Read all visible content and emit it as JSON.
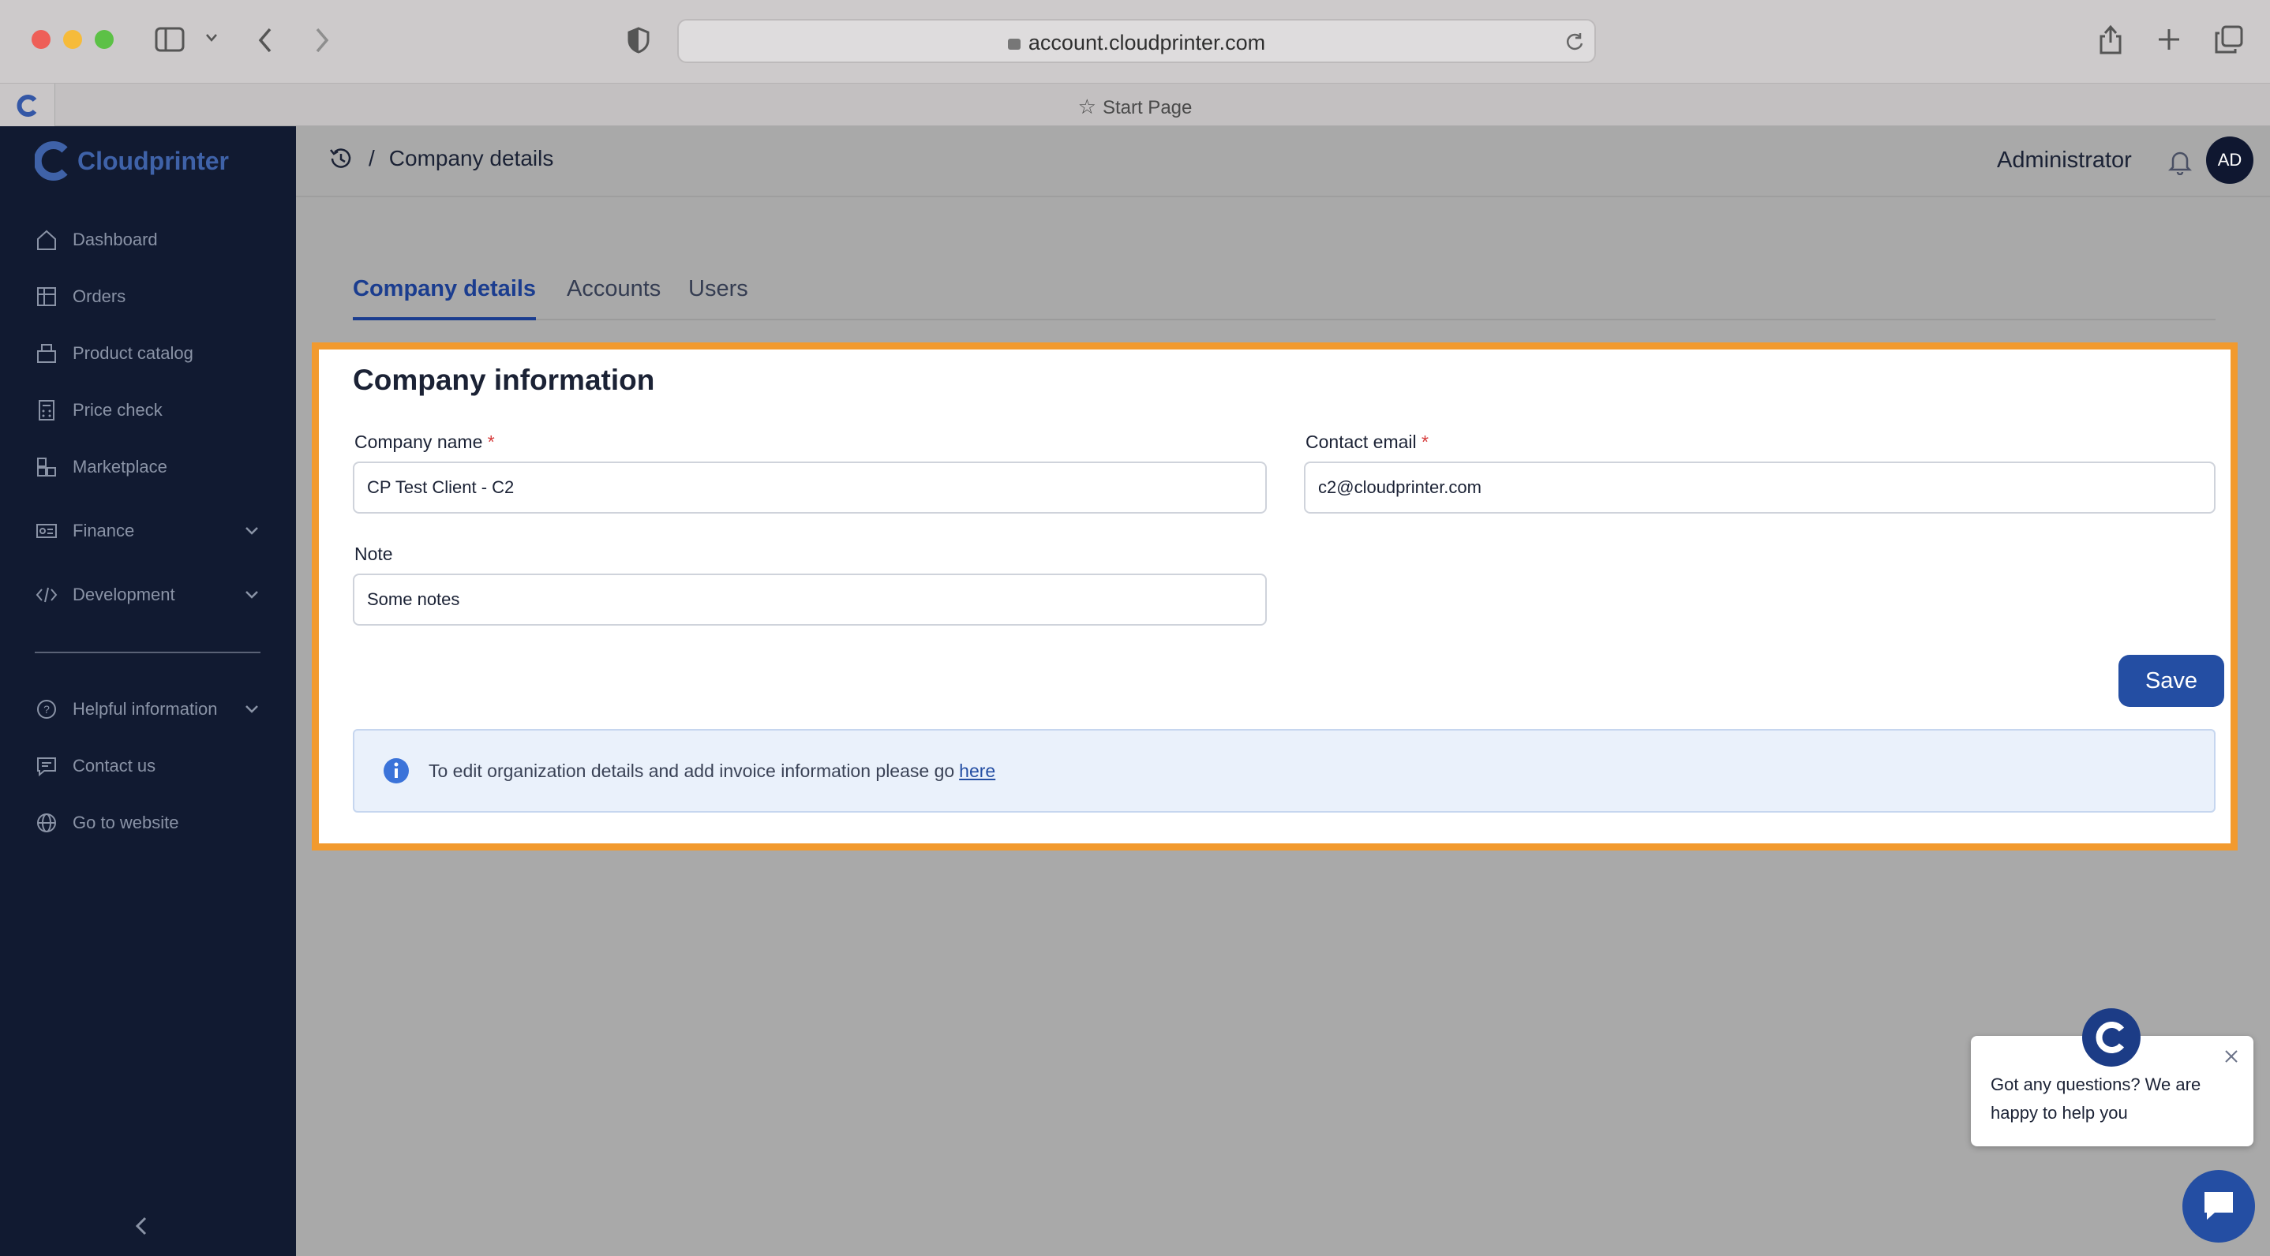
{
  "browser": {
    "url": "account.cloudprinter.com",
    "tab_title": "Start Page"
  },
  "sidebar": {
    "logo_text": "Cloudprinter",
    "items": [
      {
        "label": "Dashboard",
        "icon": "home-icon"
      },
      {
        "label": "Orders",
        "icon": "orders-icon"
      },
      {
        "label": "Product catalog",
        "icon": "product-catalog-icon"
      },
      {
        "label": "Price check",
        "icon": "calculator-icon"
      },
      {
        "label": "Marketplace",
        "icon": "marketplace-icon"
      },
      {
        "label": "Finance",
        "icon": "finance-icon"
      },
      {
        "label": "Development",
        "icon": "code-icon"
      },
      {
        "label": "Helpful information",
        "icon": "help-icon"
      },
      {
        "label": "Contact us",
        "icon": "chat-icon"
      },
      {
        "label": "Go to website",
        "icon": "globe-icon"
      }
    ]
  },
  "header": {
    "breadcrumb_sep": "/",
    "breadcrumb_title": "Company details",
    "user_name": "Administrator",
    "avatar_initials": "AD"
  },
  "tabs": [
    "Company details",
    "Accounts",
    "Users"
  ],
  "form": {
    "title": "Company information",
    "company_name_label": "Company name",
    "company_name_value": "CP Test Client - C2",
    "contact_email_label": "Contact email",
    "contact_email_value": "c2@cloudprinter.com",
    "note_label": "Note",
    "note_value": "Some notes",
    "required_mark": "*",
    "save_label": "Save"
  },
  "info": {
    "text": "To edit organization details and add invoice information please go",
    "link": "here"
  },
  "chat": {
    "message": "Got any questions? We are happy to help you"
  },
  "colors": {
    "sidebar_bg": "#111a31",
    "accent": "#244ea3",
    "highlight": "#f29a2e"
  }
}
